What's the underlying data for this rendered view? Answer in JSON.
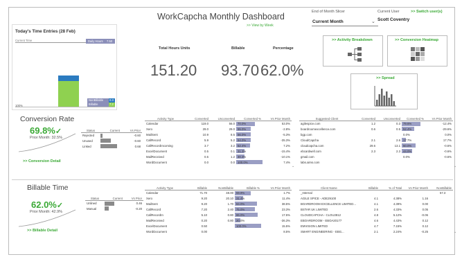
{
  "header": {
    "title": "WorkCapcha Monthly Dashboard",
    "view_by_week": ">> View by Week",
    "slicer_label": "End of Month Slicer",
    "slicer_value": "Current Month",
    "user_label": "Current User",
    "user_name": "Scott Coventry",
    "switch_user": ">> Switch user(s)"
  },
  "today": {
    "title": "Today's Time Entries (28 Feb)",
    "current_time": "Current Time",
    "daily_hours_label": "Daily Hours",
    "daily_hours_value": "7.50",
    "nonbillable_label": "NonBillable",
    "nonbillable_value": "0.3",
    "billable_label": "Billable",
    "billable_value": "7.2",
    "percent_label": "100%"
  },
  "kpis": {
    "total_hours_label": "Total Hours Units",
    "total_hours_value": "151.20",
    "billable_label": "Billable",
    "billable_value": "93.70",
    "percentage_label": "Percentage",
    "percentage_value": "62.0%"
  },
  "nav": {
    "activity_breakdown": ">> Activity Breakdown",
    "conversion_heatmap": ">> Conversion Heatmap",
    "spread": ">> Spread"
  },
  "conversion": {
    "title": "Conversion Rate",
    "value": "69.8%",
    "prior": "Prior Month: 32.5%",
    "detail": ">> Conversion Detail",
    "status_headers": [
      "Status",
      "Current",
      "Vs Prior"
    ],
    "status_rows": [
      {
        "status": "Rejected",
        "current": 0.1,
        "vs": "-0.60"
      },
      {
        "status": "Unused",
        "current": 0.5,
        "vs": "-0.60"
      },
      {
        "status": "Linked",
        "current": 0.8,
        "vs": "0.68"
      }
    ],
    "activity_headers": [
      "Activity Type",
      "Converted",
      "Unconverted",
      "Converted %",
      "Vs Prior Month"
    ],
    "activity_rows": [
      [
        "Calendar",
        "119.0",
        "56.0",
        "70.0%",
        "53.0%"
      ],
      [
        "Xero",
        "29.0",
        "29.0",
        "55.0%",
        "-2.8%"
      ],
      [
        "MailSent",
        "10.9",
        "8.5",
        "56.0%",
        "-5.3%"
      ],
      [
        "CallRecord",
        "5.9",
        "5.2",
        "54.0%",
        "-35.3%"
      ],
      [
        "CallRecordIncoming",
        "3.7",
        "3.2",
        "52.4%",
        "7.2%"
      ],
      [
        "ExcelDocument",
        "0.5",
        "0.1",
        "31.3%",
        "-15.4%"
      ],
      [
        "MailReceived",
        "0.5",
        "1.2",
        "30.3%",
        "-10.1%"
      ],
      [
        "WordDocument",
        "0.0",
        "0.0",
        "100.0%",
        "7.4%"
      ]
    ],
    "activity_fill": [
      0.7,
      0.55,
      0.56,
      0.54,
      0.524,
      0.313,
      0.303,
      1.0
    ],
    "client_headers": [
      "Suggested Client",
      "Converted",
      "Unconverted",
      "Converted %",
      "Vs Prior Month"
    ],
    "client_rows": [
      [
        "agilespice.com",
        "1.2",
        "0.3",
        "79.6%",
        "-12.4%"
      ],
      [
        "boardroomexcellence.com",
        "0.6",
        "0.5",
        "52.4%",
        "-29.6%"
      ],
      [
        "bgp.com",
        "",
        "",
        "0.0%",
        "0.0%"
      ],
      [
        "CloudCapcha",
        "2.1",
        "2.6",
        "17.7%",
        "17.7%"
      ],
      [
        "cloudcapcha.com",
        "29.6",
        "13.1",
        "60.0%",
        "-0.6%"
      ],
      [
        "ebcardwell.com",
        "2.3",
        "2.3",
        "44.0%",
        "-0.6%"
      ],
      [
        "gmail.com",
        "",
        "",
        "0.0%",
        "-0.6%"
      ],
      [
        "labs.aims.com",
        "",
        "",
        "",
        ""
      ]
    ],
    "client_fill": [
      0.796,
      0.524,
      0.0,
      0.177,
      0.6,
      0.44,
      0.0,
      0.0
    ]
  },
  "billable": {
    "title": "Billable Time",
    "value": "62.0%",
    "prior": "Prior Month: 42.9%",
    "detail": ">> Billable Detail",
    "status_headers": [
      "Status",
      "Current",
      "Vs Prior"
    ],
    "status_rows": [
      {
        "status": "Unlined",
        "current": 0.5,
        "vs": "0.46"
      },
      {
        "status": "Manual",
        "current": 0.2,
        "vs": "-0.20"
      }
    ],
    "activity_headers": [
      "Activity Type",
      "Billable",
      "NonBillable",
      "Billable %",
      "Vs Prior Month"
    ],
    "activity_rows": [
      [
        "Calendar",
        "71.70",
        "48.00",
        "59.9%",
        "1.7%"
      ],
      [
        "Xero",
        "9.20",
        "20.10",
        "31.4%",
        "11.4%"
      ],
      [
        "MailSent",
        "9.20",
        "1.70",
        "84.0%",
        "38.5%"
      ],
      [
        "CallRecord",
        "7.20",
        "2.40",
        "75.0%",
        "23.3%"
      ],
      [
        "CallRecordIn",
        "5.10",
        "0.80",
        "86.0%",
        "17.5%"
      ],
      [
        "MailReceived",
        "0.20",
        "0.80",
        "20.0%",
        "-36.3%"
      ],
      [
        "ExcelDocument",
        "0.50",
        "",
        "100.0%",
        "15.5%"
      ],
      [
        "WordDocument",
        "0.00",
        "",
        "",
        "8.5%"
      ]
    ],
    "activity_fill": [
      0.599,
      0.314,
      0.84,
      0.75,
      0.86,
      0.2,
      1.0,
      0.0
    ],
    "client_headers": [
      "Client Name",
      "Billable",
      "% of Total",
      "Vs Prior Month",
      "NonBillable"
    ],
    "client_total": "57.3",
    "client_rows": [
      [
        "_Internal",
        "",
        "",
        "",
        ""
      ],
      [
        "AGILE SPICE - ADE29100",
        "4.1",
        "4.38%",
        "1.16",
        ""
      ],
      [
        "BOARDROOM EXCELLENCE LIMITED...",
        "4.1",
        "4.39%",
        "0.00",
        ""
      ],
      [
        "BSTAR UK LIMITED",
        "2.6",
        "4.33%",
        "0.05",
        ""
      ],
      [
        "CLOUDCAPCHA - CLOU2812",
        "4.8",
        "5.12%",
        "-0.06",
        ""
      ],
      [
        "EBOARDROOM - EBOA20177",
        "4.6",
        "4.43%",
        "0.12",
        ""
      ],
      [
        "EMVISION LIMITED",
        "4.7",
        "7.15%",
        "0.12",
        ""
      ],
      [
        "SMART ENGINEERING - EBG...",
        "2.1",
        "2.24%",
        "-0.25",
        ""
      ]
    ]
  }
}
